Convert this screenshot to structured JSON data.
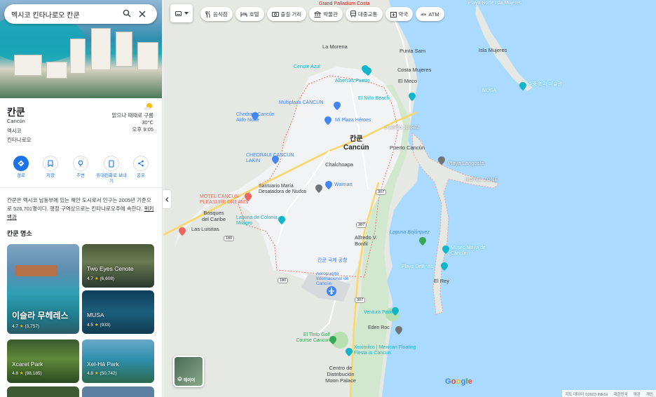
{
  "search": {
    "query": "멕시코 킨타나로오 칸쿤"
  },
  "place": {
    "name": "칸쿤",
    "latin_name": "Cancún",
    "country": "멕시코",
    "state": "킨타나로오",
    "weather": {
      "condition": "맑으나 때때로 구름",
      "temp": "30°C",
      "time": "오후 9:05"
    }
  },
  "actions": [
    {
      "label": "경로",
      "icon": "directions-icon"
    },
    {
      "label": "저장",
      "icon": "bookmark-icon"
    },
    {
      "label": "주변",
      "icon": "nearby-icon"
    },
    {
      "label": "휴대전화로 보내기",
      "icon": "phone-icon"
    },
    {
      "label": "공유",
      "icon": "share-icon"
    }
  ],
  "description": {
    "text": "칸쿤은 멕시코 남동부에 있는 해안 도시로서 인구는 2005년 기준으로 526,701명이다. 행정 구역상으로는 킨타나로오주에 속한다.",
    "link": "위키백과"
  },
  "places_heading": "칸쿤 명소",
  "places": [
    {
      "name": "이슬라 무헤레스",
      "rating": "4.7",
      "reviews": "(3,757)"
    },
    {
      "name": "Two Eyes Cenote",
      "rating": "4.7",
      "reviews": "(6,608)"
    },
    {
      "name": "MUSA",
      "rating": "4.5",
      "reviews": "(933)"
    },
    {
      "name": "Xcaret Park",
      "rating": "4.8",
      "reviews": "(98,185)"
    },
    {
      "name": "Xel-Há Park",
      "rating": "4.8",
      "reviews": "(50,742)"
    }
  ],
  "chips": [
    {
      "label": "음식점",
      "icon": "restaurant-icon"
    },
    {
      "label": "호텔",
      "icon": "hotel-icon"
    },
    {
      "label": "즐길 거리",
      "icon": "camera-icon"
    },
    {
      "label": "박물관",
      "icon": "museum-icon"
    },
    {
      "label": "대중교통",
      "icon": "transit-icon"
    },
    {
      "label": "약국",
      "icon": "pharmacy-icon"
    },
    {
      "label": "ATM",
      "icon": "atm-icon"
    }
  ],
  "layers_label": "레이어",
  "map": {
    "city_kr": "칸쿤",
    "city_en": "Cancún",
    "labels": {
      "grand_palladium": "Grand Palladium Costa",
      "playa_norte": "Playa Norte Isla Mujeres",
      "la_morena": "La Morena",
      "punta_sam": "Punta Sam",
      "isla_mujeres": "Isla Mujeres",
      "cenote_azul": "Cenote Azul",
      "costa_mujeres": "Costa Mujeres",
      "albercas": "Albercas Puerto",
      "el_meco": "El Meco",
      "multiplaza": "Multiplaza CANCUN",
      "el_nino": "El Niño Beach",
      "chedraui_norte": "Chedraui Cancún Aldo Norte",
      "mi_plaza": "Mi Plaza Héroes",
      "musa": "MUSA",
      "underwater": "수중 조각 미술관",
      "puerto_juarez": "PUERTO JUAREZ",
      "puerto_cancun": "Puerto Cancún",
      "chedraui_lakin": "CHEDRAUI CANCUN LAKIN",
      "chalchoapa": "Chalchoapa",
      "playa_langosta": "Playa Langosta",
      "hotel_zone": "HOTEL ZONE",
      "motel": "MOTEL CANCUN PLEASURE DREAMS",
      "santuario": "Santuario María Desatadora de Nudos",
      "walmart": "Walmart",
      "bosques": "Bosques del Caribe",
      "las_luisitas": "Las Luisitas",
      "laguna": "Laguna de Colonia Milagro",
      "alfredo": "Alfredo V. Bonfil",
      "laguna_bojorquez": "Laguna Bojórquez",
      "museo_maya": "Museo Maya de Cancún",
      "airport": "칸쿤 국제 공항",
      "airport_en": "Aeropuerto Internacional de Cancún",
      "playa_delfines": "Playa Delfines",
      "el_rey": "El Rey",
      "ventura": "Ventura Park",
      "eden": "Eden Roc",
      "el_tinto": "El Tinto Golf Course Cancun",
      "xoximilco": "Xoximilco | Mexican Floating Fiesta in Cancun",
      "centro": "Centro de Distribución Moon Palace",
      "r307a": "307",
      "r307b": "307",
      "r307c": "307",
      "r180a": "180",
      "r180b": "180"
    }
  },
  "footer": {
    "data": "지도 데이터 ©2023 INEGI",
    "country": "대한민국",
    "terms": "약관",
    "feedback": "개인"
  },
  "google": "Google"
}
